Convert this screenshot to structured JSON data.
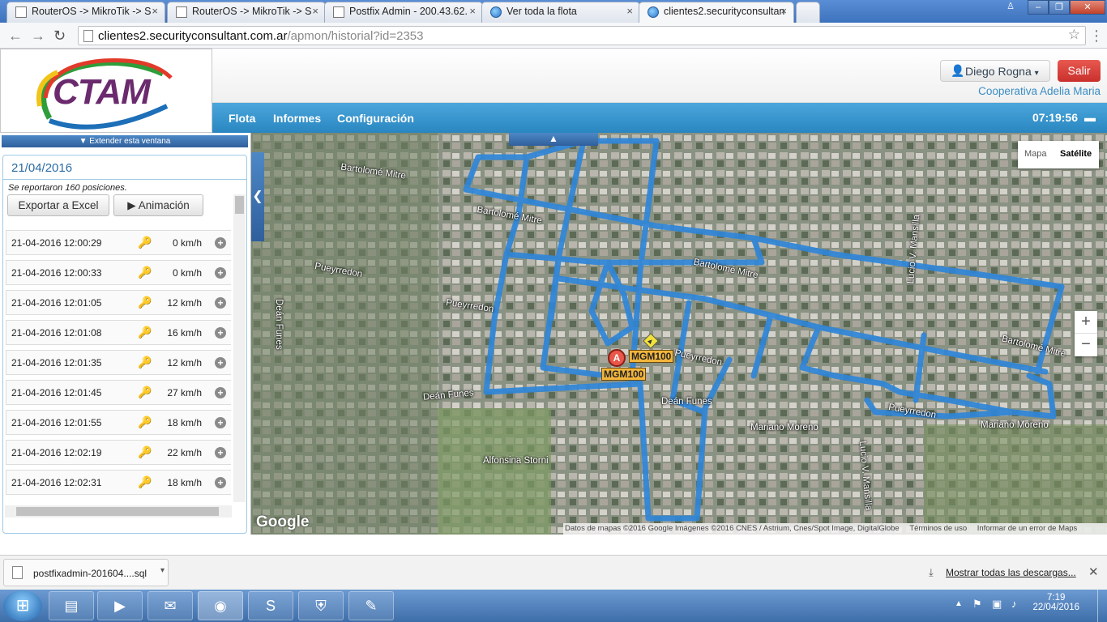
{
  "browser": {
    "tabs": [
      {
        "label": "RouterOS -> MikroTik -> S",
        "icon": "page-icon",
        "active": false
      },
      {
        "label": "RouterOS -> MikroTik -> S",
        "icon": "page-icon",
        "active": false
      },
      {
        "label": "Postfix Admin - 200.43.62.",
        "icon": "page-icon",
        "active": false
      },
      {
        "label": "Ver toda la flota",
        "icon": "globe-icon",
        "active": false
      },
      {
        "label": "clientes2.securityconsultan",
        "icon": "globe-icon",
        "active": true
      }
    ],
    "url_host": "clientes2.securityconsultant.com.ar",
    "url_path": "/apmon/historial?id=2353"
  },
  "header": {
    "logo_text": "CTAM",
    "user_name": "Diego Rogna",
    "logout_label": "Salir",
    "cooperative": "Cooperativa Adelia Maria",
    "menu": [
      "Flota",
      "Informes",
      "Configuración"
    ],
    "clock": "07:19:56"
  },
  "left_panel": {
    "extend_label": "Extender esta ventana",
    "date": "21/04/2016",
    "summary": "Se reportaron 160 posiciones.",
    "export_label": "Exportar a Excel",
    "animation_label": "Animación",
    "positions": [
      {
        "time": "21-04-2016 12:00:29",
        "speed": "0 km/h"
      },
      {
        "time": "21-04-2016 12:00:33",
        "speed": "0 km/h"
      },
      {
        "time": "21-04-2016 12:01:05",
        "speed": "12 km/h"
      },
      {
        "time": "21-04-2016 12:01:08",
        "speed": "16 km/h"
      },
      {
        "time": "21-04-2016 12:01:35",
        "speed": "12 km/h"
      },
      {
        "time": "21-04-2016 12:01:45",
        "speed": "27 km/h"
      },
      {
        "time": "21-04-2016 12:01:55",
        "speed": "18 km/h"
      },
      {
        "time": "21-04-2016 12:02:19",
        "speed": "22 km/h"
      },
      {
        "time": "21-04-2016 12:02:31",
        "speed": "18 km/h"
      }
    ]
  },
  "map": {
    "map_type_options": [
      "Mapa",
      "Satélite"
    ],
    "selected_type": "Satélite",
    "zoom_in": "+",
    "zoom_out": "−",
    "google_logo": "Google",
    "attribution": "Datos de mapas ©2016 Google Imágenes ©2016 CNES / Astrium, Cnes/Spot Image, DigitalGlobe",
    "terms": "Términos de uso",
    "report": "Informar de un error de Maps",
    "streets": [
      "Bartolomé Mitre",
      "Bartolomé Mitre",
      "Bartolomé Mitre",
      "Bartolomé Mitre",
      "Pueyrredon",
      "Pueyrredon",
      "Pueyrredon",
      "Pueyrredon",
      "Deán Funes",
      "Deán Funes",
      "Deán Funes",
      "Mariano Moreno",
      "Mariano Moreno",
      "Alfonsina Storni",
      "Lucio V. Mansilla",
      "Lucio V. Mansilla"
    ],
    "marker_letter": "A",
    "vehicle_labels": [
      "MGM100",
      "MGM100"
    ]
  },
  "downloads": {
    "file": "postfixadmin-201604....sql",
    "show_all": "Mostrar todas las descargas..."
  },
  "taskbar": {
    "time": "7:19",
    "date": "22/04/2016"
  }
}
